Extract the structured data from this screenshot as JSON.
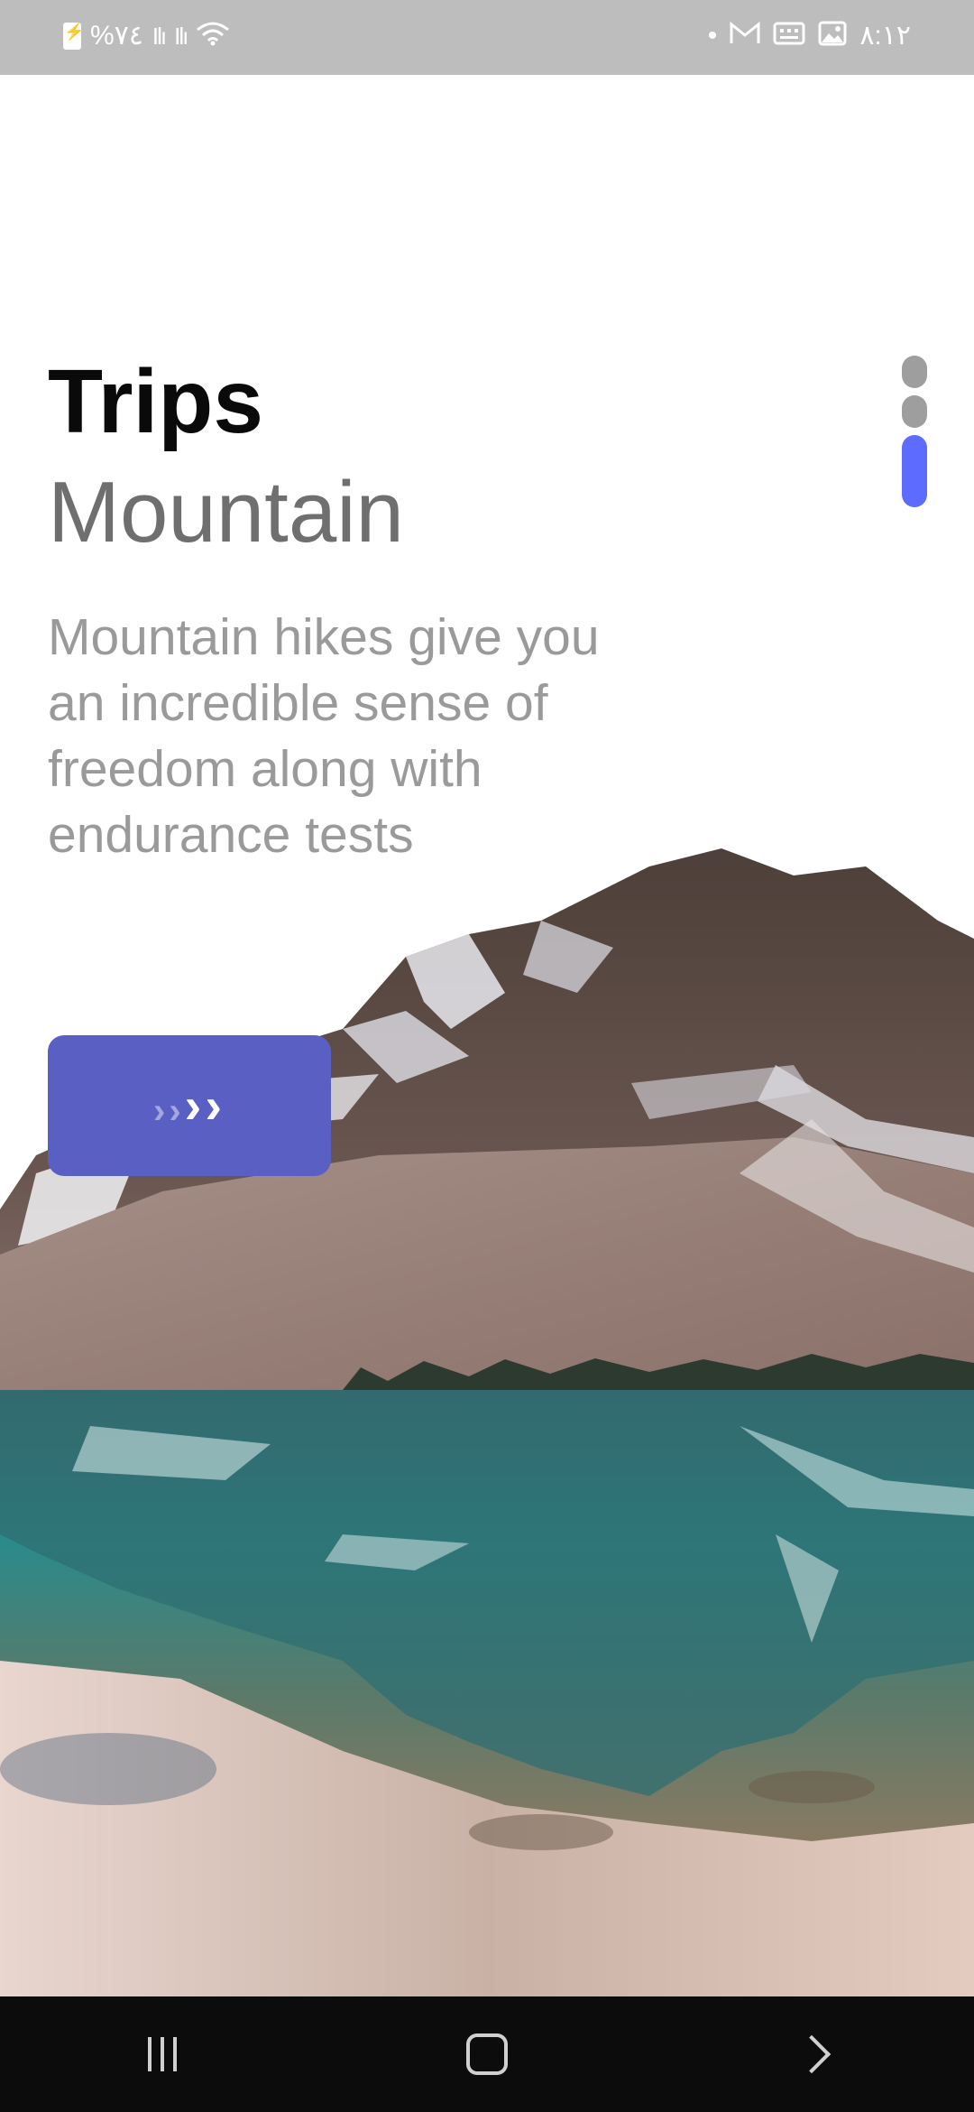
{
  "status_bar": {
    "battery_text": "%٧٤",
    "time": "٨:١٢"
  },
  "content": {
    "title": "Trips",
    "subtitle": "Mountain",
    "description": "Mountain hikes give you an incredible sense of freedom along with endurance tests"
  },
  "next_button": {
    "icon": "chevrons-right-icon"
  },
  "page_indicator": {
    "total": 3,
    "active_index": 2
  },
  "colors": {
    "accent": "#5a5fc4",
    "indicator_active": "#5d6bff",
    "indicator_inactive": "#9e9e9e",
    "status_bar": "#bdbdbd",
    "nav_bar": "#0c0c0c"
  }
}
